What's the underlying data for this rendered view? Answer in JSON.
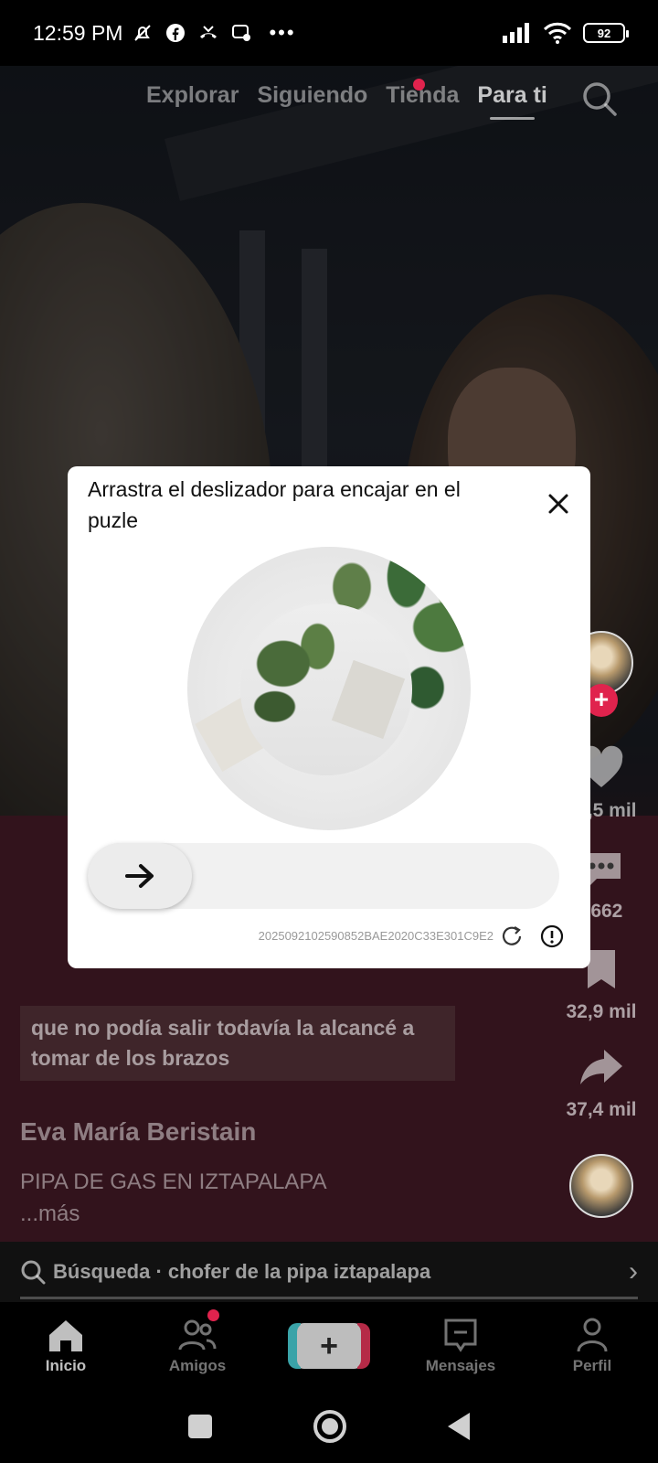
{
  "status_bar": {
    "time": "12:59 PM",
    "more": "•••",
    "battery": "92"
  },
  "top_nav": {
    "tabs": [
      "Explorar",
      "Siguiendo",
      "Tienda",
      "Para ti"
    ],
    "active": "Para ti"
  },
  "rail": {
    "likes": "43,5 mil",
    "comments": "5662",
    "saves": "32,9 mil",
    "shares": "37,4 mil"
  },
  "video": {
    "caption": "que no podía salir todavía la alcancé a tomar de los brazos",
    "author": "Eva María Beristain",
    "description": "PIPA DE GAS EN IZTAPALAPA",
    "more": "...más"
  },
  "search_bar": {
    "text": "Búsqueda · chofer de la pipa iztapalapa"
  },
  "bottom_nav": {
    "home": "Inicio",
    "friends": "Amigos",
    "messages": "Mensajes",
    "profile": "Perfil"
  },
  "captcha": {
    "title": "Arrastra el deslizador para encajar en el puzle",
    "id": "2025092102590852BAE2020C33E301C9E2",
    "slider_progress": 0
  },
  "colors": {
    "accent_red": "#e0234d",
    "modal_bg": "#ffffff",
    "nav_bg": "#000000"
  }
}
